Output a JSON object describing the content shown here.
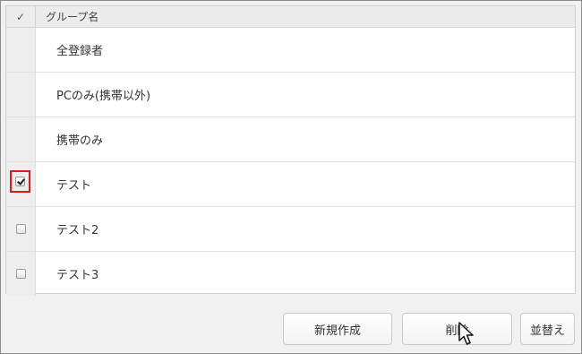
{
  "table": {
    "header": {
      "check_symbol": "✓",
      "name_label": "グループ名"
    },
    "rows": [
      {
        "name": "全登録者",
        "checkbox": "none",
        "checked": false
      },
      {
        "name": "PCのみ(携帯以外)",
        "checkbox": "none",
        "checked": false
      },
      {
        "name": "携帯のみ",
        "checkbox": "none",
        "checked": false
      },
      {
        "name": "テスト",
        "checkbox": "shown",
        "checked": true
      },
      {
        "name": "テスト2",
        "checkbox": "shown",
        "checked": false
      },
      {
        "name": "テスト3",
        "checkbox": "shown",
        "checked": false
      }
    ]
  },
  "toolbar": {
    "new_label": "新規作成",
    "delete_label": "削除",
    "sort_label": "並替え"
  },
  "colors": {
    "highlight": "#e01818",
    "header_bg": "#ececec",
    "panel_bg": "#f1f1f1"
  },
  "icons": {
    "cursor": "mouse-pointer-icon"
  }
}
